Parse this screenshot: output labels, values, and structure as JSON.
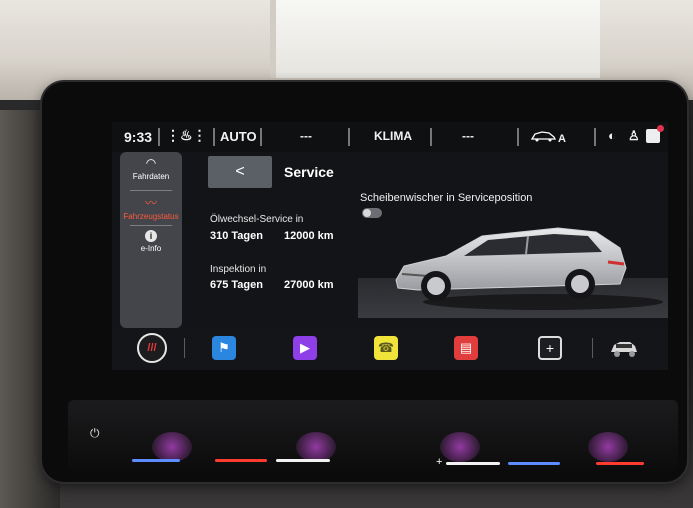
{
  "status_bar": {
    "time": "9:33",
    "seat_icon": "seat-heat-icon",
    "auto": "AUTO",
    "left_temp": "---",
    "klima": "KLIMA",
    "right_temp": "---",
    "car_icon": "car-a-icon",
    "icons": [
      "navigation-icon",
      "user-icon",
      "message-icon"
    ]
  },
  "left_nav": {
    "items": [
      {
        "label": "Fahrdaten",
        "icon": "gauge-icon"
      },
      {
        "label": "Fahrzeugstatus",
        "icon": "pulse-icon",
        "active": true
      },
      {
        "label": "e-Info",
        "icon": "info-icon"
      }
    ]
  },
  "main": {
    "back_symbol": "<",
    "title": "Service",
    "oil": {
      "label": "Ölwechsel-Service in",
      "days": "310 Tagen",
      "km": "12000 km"
    },
    "inspection": {
      "label": "Inspektion in",
      "days": "675 Tagen",
      "km": "27000 km"
    },
    "wiper": {
      "label": "Scheibenwischer in Serviceposition",
      "enabled": false
    }
  },
  "dock": {
    "items": [
      {
        "name": "hazard",
        "symbol": "///"
      },
      {
        "name": "navigation-flag",
        "symbol": "⚑"
      },
      {
        "name": "media-play",
        "symbol": "▶"
      },
      {
        "name": "phone",
        "symbol": "☎"
      },
      {
        "name": "messages",
        "symbol": "▤"
      },
      {
        "name": "add",
        "symbol": "+"
      },
      {
        "name": "vehicle",
        "symbol": "🚗"
      }
    ]
  },
  "hardware": {
    "power_symbol": "⏻",
    "plus_symbol": "+"
  },
  "colors": {
    "accent_red": "#ff5a3c",
    "screen_bg": "#131417",
    "nav_bg": "#43454b"
  }
}
